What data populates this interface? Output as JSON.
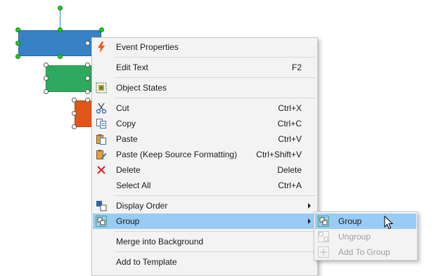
{
  "colors": {
    "shape_blue": "#3682c4",
    "shape_green": "#2eaa5f",
    "shape_orange": "#e0561a",
    "menu_bg": "#f3f3f3",
    "highlight": "#99ccf5",
    "disabled_text": "#a0a0a0"
  },
  "context_menu": {
    "items": [
      {
        "label": "Event Properties",
        "shortcut": "",
        "icon": "lightning-icon"
      },
      {
        "label": "Edit Text",
        "shortcut": "F2",
        "icon": ""
      },
      {
        "label": "Object States",
        "shortcut": "",
        "icon": "object-states-icon"
      },
      {
        "label": "Cut",
        "shortcut": "Ctrl+X",
        "icon": "scissors-icon"
      },
      {
        "label": "Copy",
        "shortcut": "Ctrl+C",
        "icon": "copy-icon"
      },
      {
        "label": "Paste",
        "shortcut": "Ctrl+V",
        "icon": "paste-icon"
      },
      {
        "label": "Paste (Keep Source Formatting)",
        "shortcut": "Ctrl+Shift+V",
        "icon": "paste-format-icon"
      },
      {
        "label": "Delete",
        "shortcut": "Delete",
        "icon": "delete-x-icon"
      },
      {
        "label": "Select All",
        "shortcut": "Ctrl+A",
        "icon": ""
      },
      {
        "label": "Display Order",
        "shortcut": "",
        "icon": "display-order-icon",
        "has_submenu": true
      },
      {
        "label": "Group",
        "shortcut": "",
        "icon": "group-icon",
        "has_submenu": true,
        "highlighted": true
      },
      {
        "label": "Merge into Background",
        "shortcut": "",
        "icon": ""
      },
      {
        "label": "Add to Template",
        "shortcut": "",
        "icon": ""
      }
    ]
  },
  "group_submenu": {
    "items": [
      {
        "label": "Group",
        "enabled": true,
        "highlighted": true,
        "icon": "group-icon"
      },
      {
        "label": "Ungroup",
        "enabled": false,
        "icon": "ungroup-icon"
      },
      {
        "label": "Add To Group",
        "enabled": false,
        "icon": "add-to-group-icon"
      }
    ]
  }
}
